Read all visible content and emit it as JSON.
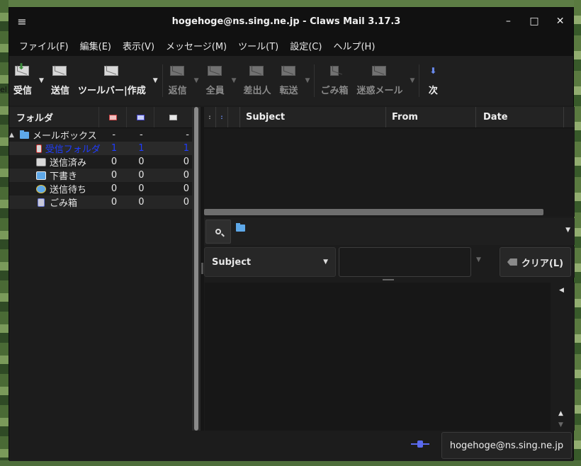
{
  "window": {
    "title": "hogehoge@ns.sing.ne.jp - Claws Mail 3.17.3",
    "menu_icon": "≡",
    "minimize": "–",
    "maximize": "□",
    "close": "✕"
  },
  "desktop": {
    "fragment_text": "el"
  },
  "menubar": [
    "ファイル(F)",
    "編集(E)",
    "表示(V)",
    "メッセージ(M)",
    "ツール(T)",
    "設定(C)",
    "ヘルプ(H)"
  ],
  "toolbar": {
    "receive": "受信",
    "send": "送信",
    "compose": "ツールバー|作成",
    "reply": "返信",
    "reply_all": "全員",
    "reply_sender": "差出人",
    "forward": "転送",
    "trash": "ごみ箱",
    "spam": "迷惑メール",
    "next": "次"
  },
  "folder_panel": {
    "header": {
      "name": "フォルダ"
    },
    "rows": [
      {
        "name": "メールボックス",
        "new": "-",
        "unread": "-",
        "total": "-"
      },
      {
        "name": "受信フォルダ",
        "new": "1",
        "unread": "1",
        "total": "1"
      },
      {
        "name": "送信済み",
        "new": "0",
        "unread": "0",
        "total": "0"
      },
      {
        "name": "下書き",
        "new": "0",
        "unread": "0",
        "total": "0"
      },
      {
        "name": "送信待ち",
        "new": "0",
        "unread": "0",
        "total": "0"
      },
      {
        "name": "ごみ箱",
        "new": "0",
        "unread": "0",
        "total": "0"
      }
    ]
  },
  "message_list": {
    "columns": {
      "subject": "Subject",
      "from": "From",
      "date": "Date"
    }
  },
  "quick_search": {
    "field_type": "Subject",
    "value": "",
    "clear_label": "クリア(L)"
  },
  "status": {
    "account": "hogehoge@ns.sing.ne.jp"
  },
  "colors": {
    "selected_text": "#1f3cff",
    "background": "#1c1c1c"
  }
}
